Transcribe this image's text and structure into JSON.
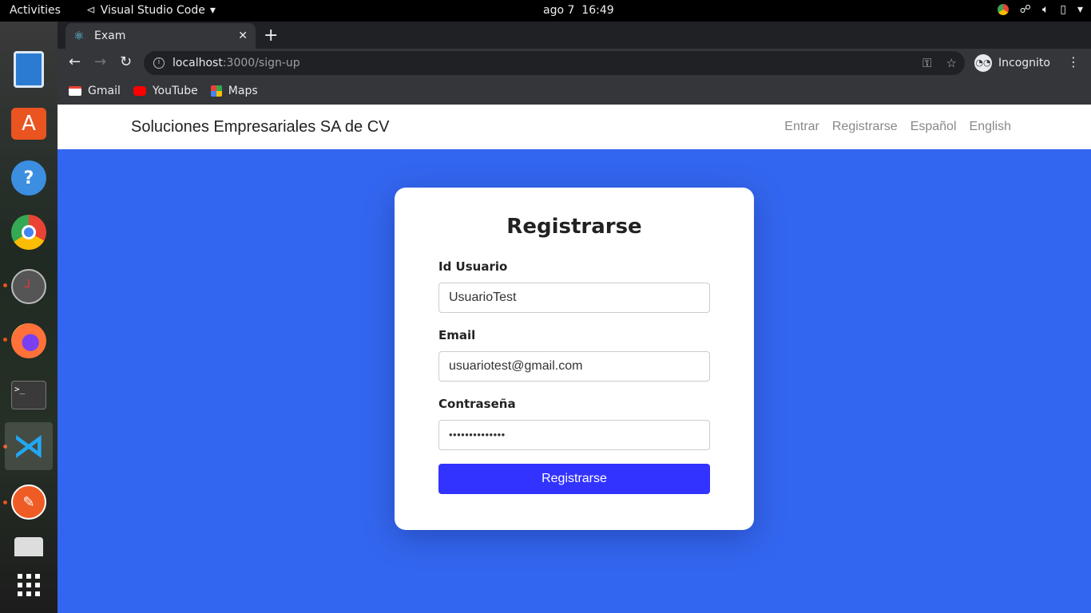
{
  "topbar": {
    "activities": "Activities",
    "app_name": "Visual Studio Code",
    "date": "ago 7",
    "time": "16:49"
  },
  "browser": {
    "tab_title": "Exam",
    "url_host": "localhost",
    "url_path": ":3000/sign-up",
    "incognito_label": "Incognito",
    "bookmarks": [
      "Gmail",
      "YouTube",
      "Maps"
    ]
  },
  "navbar": {
    "brand": "Soluciones Empresariales SA de CV",
    "links": [
      "Entrar",
      "Registrarse",
      "Español",
      "English"
    ]
  },
  "form": {
    "title": "Registrarse",
    "user_label": "Id Usuario",
    "user_value": "UsuarioTest",
    "email_label": "Email",
    "email_value": "usuariotest@gmail.com",
    "password_label": "Contraseña",
    "password_value": "••••••••••••••",
    "submit_label": "Registrarse"
  },
  "colors": {
    "page_bg": "#3366f0",
    "button": "#3333ff"
  }
}
